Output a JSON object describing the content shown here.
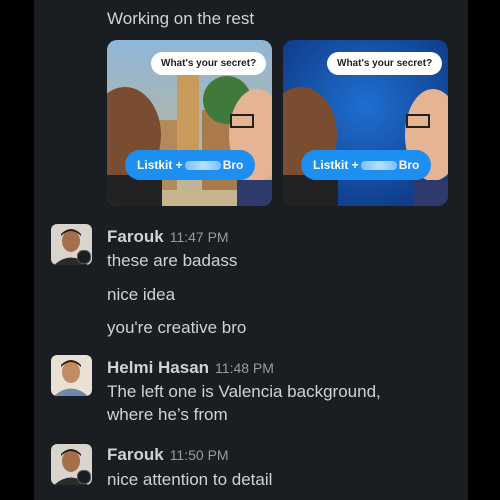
{
  "intro_text": "Working on the rest",
  "thumbnails": [
    {
      "bubble": "What's your secret?",
      "pill_left": "Listkit +",
      "pill_right": "Bro",
      "background": "valencia"
    },
    {
      "bubble": "What's your secret?",
      "pill_left": "Listkit +",
      "pill_right": "Bro",
      "background": "blue"
    }
  ],
  "messages": [
    {
      "author": "Farouk",
      "time": "11:47 PM",
      "lines": [
        "these are badass",
        "nice idea",
        "you're creative bro"
      ]
    },
    {
      "author": "Helmi Hasan",
      "time": "11:48 PM",
      "lines": [
        "The left one is Valencia background,",
        "where he’s from"
      ]
    },
    {
      "author": "Farouk",
      "time": "11:50 PM",
      "lines": [
        "nice attention to detail"
      ]
    }
  ],
  "colors": {
    "panel": "#1a1d21",
    "text": "#d1d2d3",
    "pill": "#1d8ff0"
  }
}
